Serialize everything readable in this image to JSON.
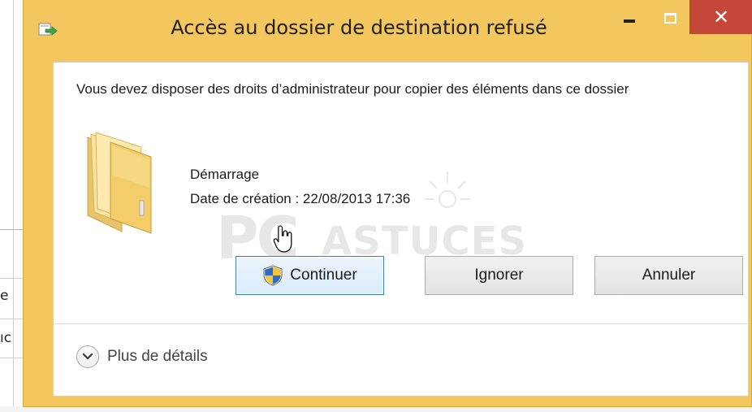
{
  "background": {
    "fragment_1": "e",
    "fragment_2": "ıc"
  },
  "dialog": {
    "title": "Accès au dossier de destination refusé",
    "title_icon": "file-transfer-icon",
    "controls": {
      "minimize_icon": "minimize-icon",
      "maximize_icon": "maximize-icon",
      "close_icon": "close-icon",
      "close_glyph": "✕"
    },
    "message": "Vous devez disposer des droits d’administrateur pour copier des éléments dans ce dossier",
    "item": {
      "icon": "folder-icon",
      "name": "Démarrage",
      "date": "Date de création : 22/08/2013 17:36"
    },
    "watermark": {
      "pc": "PC",
      "astuces": "ASTUCES"
    },
    "buttons": {
      "continue": "Continuer",
      "continue_icon": "uac-shield-icon",
      "ignore": "Ignorer",
      "cancel": "Annuler"
    },
    "details": {
      "label": "Plus de détails",
      "icon": "chevron-down-icon"
    }
  },
  "colors": {
    "frame": "#f4c65e",
    "close": "#c7463a",
    "focus_border": "#3c7fb1"
  }
}
